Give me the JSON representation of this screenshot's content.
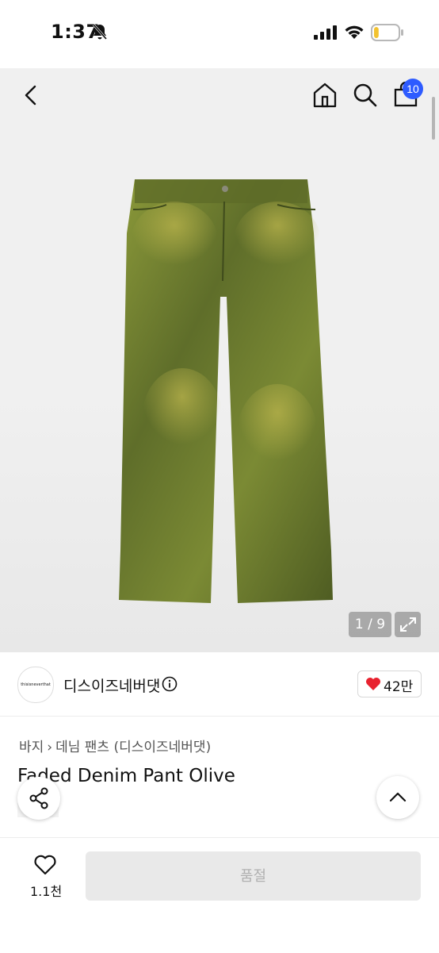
{
  "status_bar": {
    "time": "1:37",
    "battery_level": 0.2
  },
  "nav": {
    "cart_count": "10"
  },
  "gallery": {
    "counter": "1 / 9"
  },
  "brand": {
    "logo_text": "thisisneverthat",
    "name": "디스이즈네버댓",
    "likes": "42만"
  },
  "product": {
    "breadcrumb": [
      "바지",
      "데님 팬츠 (디스이즈네버댓)"
    ],
    "title": "Faded Denim Pant Olive"
  },
  "bottom_bar": {
    "wishlist_count": "1.1천",
    "soldout_label": "품절"
  },
  "colors": {
    "accent_blue": "#2e5bff",
    "heart_red": "#e8222f"
  },
  "icons": [
    "bell-slash-icon",
    "signal-icon",
    "wifi-icon",
    "battery-icon",
    "back-icon",
    "home-icon",
    "search-icon",
    "cart-icon",
    "expand-icon",
    "info-icon",
    "heart-icon",
    "share-icon",
    "chevron-up-icon"
  ]
}
